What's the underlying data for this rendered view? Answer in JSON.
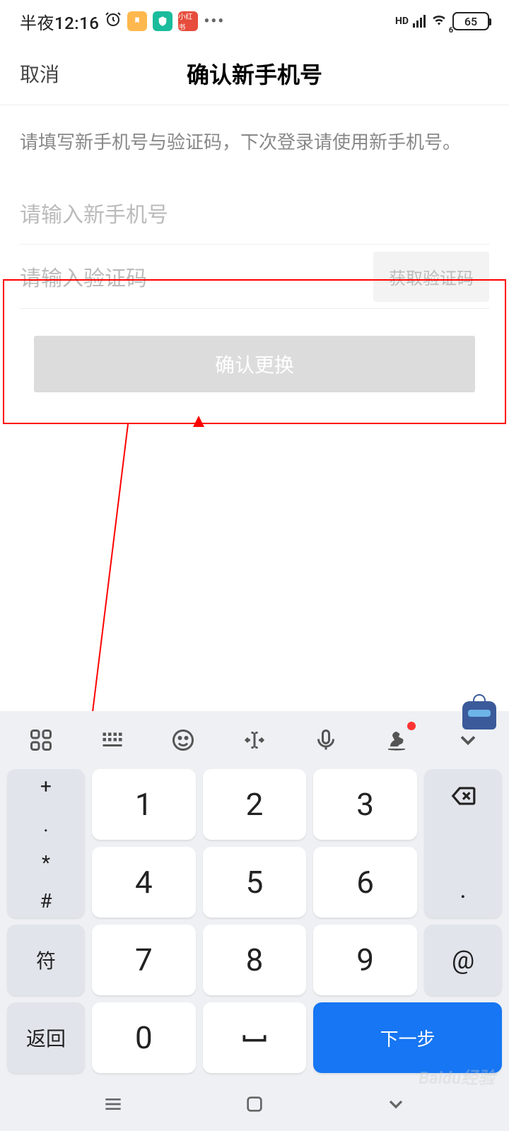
{
  "statusBar": {
    "time": "半夜12:16",
    "battery": "65"
  },
  "header": {
    "cancel": "取消",
    "title": "确认新手机号"
  },
  "form": {
    "instruction": "请填写新手机号与验证码，下次登录请使用新手机号。",
    "phonePlaceholder": "请输入新手机号",
    "codePlaceholder": "请输入验证码",
    "getCode": "获取验证码",
    "confirm": "确认更换"
  },
  "keyboard": {
    "sideLeft": [
      "+",
      ".",
      "*",
      "#"
    ],
    "sym": "符",
    "back": "返回",
    "next": "下一步",
    "nums": {
      "1": "1",
      "2": "2",
      "3": "3",
      "4": "4",
      "5": "5",
      "6": "6",
      "7": "7",
      "8": "8",
      "9": "9",
      "0": "0"
    },
    "period": ".",
    "at": "@",
    "space": "⌣"
  },
  "watermark": "Baidu经验"
}
